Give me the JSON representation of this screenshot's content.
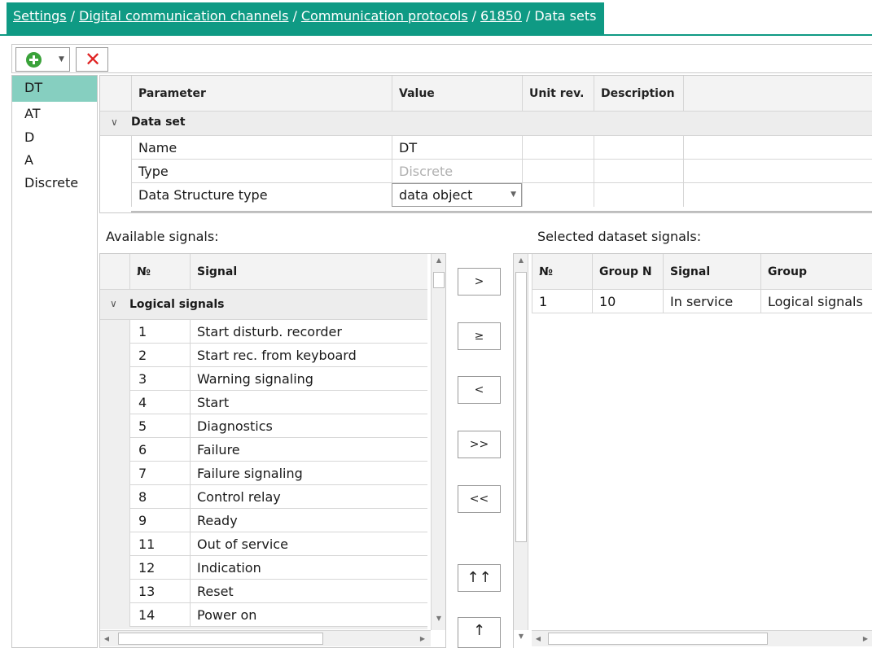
{
  "breadcrumb": {
    "items": [
      "Settings",
      "Digital communication channels",
      "Communication protocols",
      "61850"
    ],
    "current": "Data sets",
    "separator": "/"
  },
  "toolbar": {
    "add_icon": "plus-circle-icon",
    "dropdown_icon": "chevron-down-icon",
    "delete_icon": "close-icon",
    "add_glyph": "▼",
    "delete_glyph": "✕"
  },
  "dataset_list": [
    "DT",
    "AT",
    "D",
    "A",
    "Discrete"
  ],
  "dataset_list_selected": "DT",
  "parameters": {
    "columns": [
      "Parameter",
      "Value",
      "Unit rev.",
      "Description"
    ],
    "group": "Data set",
    "rows": [
      {
        "parameter": "Name",
        "value": "DT"
      },
      {
        "parameter": "Type",
        "value": "Discrete"
      },
      {
        "parameter": "Data Structure type",
        "value": "data object"
      }
    ]
  },
  "available": {
    "label": "Available signals:",
    "columns": [
      "№",
      "Signal"
    ],
    "group": "Logical signals",
    "rows": [
      {
        "num": "1",
        "signal": "Start disturb. recorder"
      },
      {
        "num": "2",
        "signal": "Start rec. from keyboard"
      },
      {
        "num": "3",
        "signal": "Warning signaling"
      },
      {
        "num": "4",
        "signal": "Start"
      },
      {
        "num": "5",
        "signal": "Diagnostics"
      },
      {
        "num": "6",
        "signal": "Failure"
      },
      {
        "num": "7",
        "signal": "Failure signaling"
      },
      {
        "num": "8",
        "signal": "Control relay"
      },
      {
        "num": "9",
        "signal": "Ready"
      },
      {
        "num": "11",
        "signal": "Out of service"
      },
      {
        "num": "12",
        "signal": "Indication"
      },
      {
        "num": "13",
        "signal": "Reset"
      },
      {
        "num": "14",
        "signal": "Power on"
      }
    ]
  },
  "transfer_buttons": {
    "add": ">",
    "add_ge": "≥",
    "remove": "<",
    "add_all": ">>",
    "remove_all": "<<",
    "move_top": "↑↑",
    "move_up": "↑"
  },
  "selected": {
    "label": "Selected dataset signals:",
    "columns": [
      "№",
      "Group N",
      "Signal",
      "Group"
    ],
    "rows": [
      {
        "num": "1",
        "group_n": "10",
        "signal": "In service",
        "group": "Logical signals"
      }
    ]
  },
  "colors": {
    "accent": "#0f9a84",
    "selection": "#86cfc0",
    "delete": "#e02424",
    "add": "#3aa23a"
  }
}
